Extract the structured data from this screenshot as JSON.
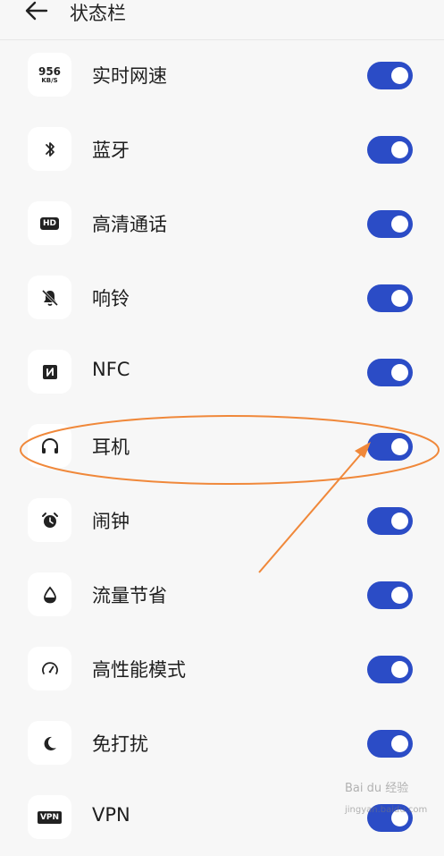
{
  "header": {
    "title": "状态栏",
    "back_icon": "arrow-left-icon"
  },
  "rows": [
    {
      "id": "realtime-speed",
      "label": "实时网速",
      "icon": "network-speed-icon",
      "speed_number": "956",
      "speed_unit": "KB/S",
      "enabled": true
    },
    {
      "id": "bluetooth",
      "label": "蓝牙",
      "icon": "bluetooth-icon",
      "enabled": true
    },
    {
      "id": "hd-call",
      "label": "高清通话",
      "icon": "hd-icon",
      "badge_text": "HD",
      "enabled": true
    },
    {
      "id": "ringer",
      "label": "响铃",
      "icon": "bell-off-icon",
      "enabled": true
    },
    {
      "id": "nfc",
      "label": "NFC",
      "icon": "nfc-icon",
      "enabled": true
    },
    {
      "id": "headphones",
      "label": "耳机",
      "icon": "headphones-icon",
      "enabled": true
    },
    {
      "id": "alarm",
      "label": "闹钟",
      "icon": "alarm-clock-icon",
      "enabled": true
    },
    {
      "id": "data-saver",
      "label": "流量节省",
      "icon": "water-drop-icon",
      "enabled": true
    },
    {
      "id": "high-performance",
      "label": "高性能模式",
      "icon": "speedometer-icon",
      "enabled": true
    },
    {
      "id": "do-not-disturb",
      "label": "免打扰",
      "icon": "moon-icon",
      "enabled": true
    },
    {
      "id": "vpn",
      "label": "VPN",
      "icon": "vpn-icon",
      "badge_text": "VPN",
      "enabled": true
    }
  ],
  "colors": {
    "toggle_on": "#2b4cc6",
    "annotation": "#f0883a",
    "background": "#f7f7f7"
  },
  "watermark": {
    "text": "Bai du 经验",
    "url": "jingyan.baidu.com"
  }
}
